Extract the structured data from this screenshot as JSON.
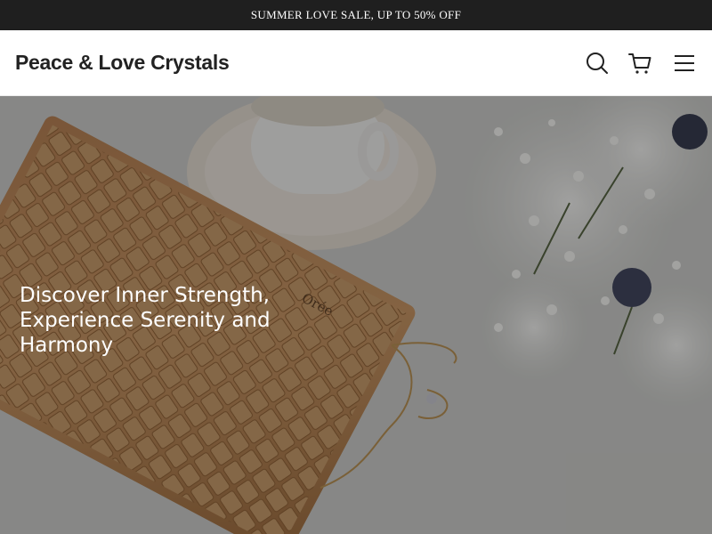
{
  "announcement": {
    "text": "SUMMER LOVE SALE, UP TO 50% OFF"
  },
  "header": {
    "logo": "Peace & Love Crystals",
    "icons": [
      "search-icon",
      "cart-icon",
      "menu-icon"
    ]
  },
  "hero": {
    "heading": "Discover Inner Strength, Experience Serenity and Harmony",
    "keyboard_brand": "Orée"
  },
  "colors": {
    "announcement_bg": "#1f1f1f",
    "header_bg": "#ffffff",
    "text_dark": "#222222",
    "hero_text": "#ffffff"
  }
}
